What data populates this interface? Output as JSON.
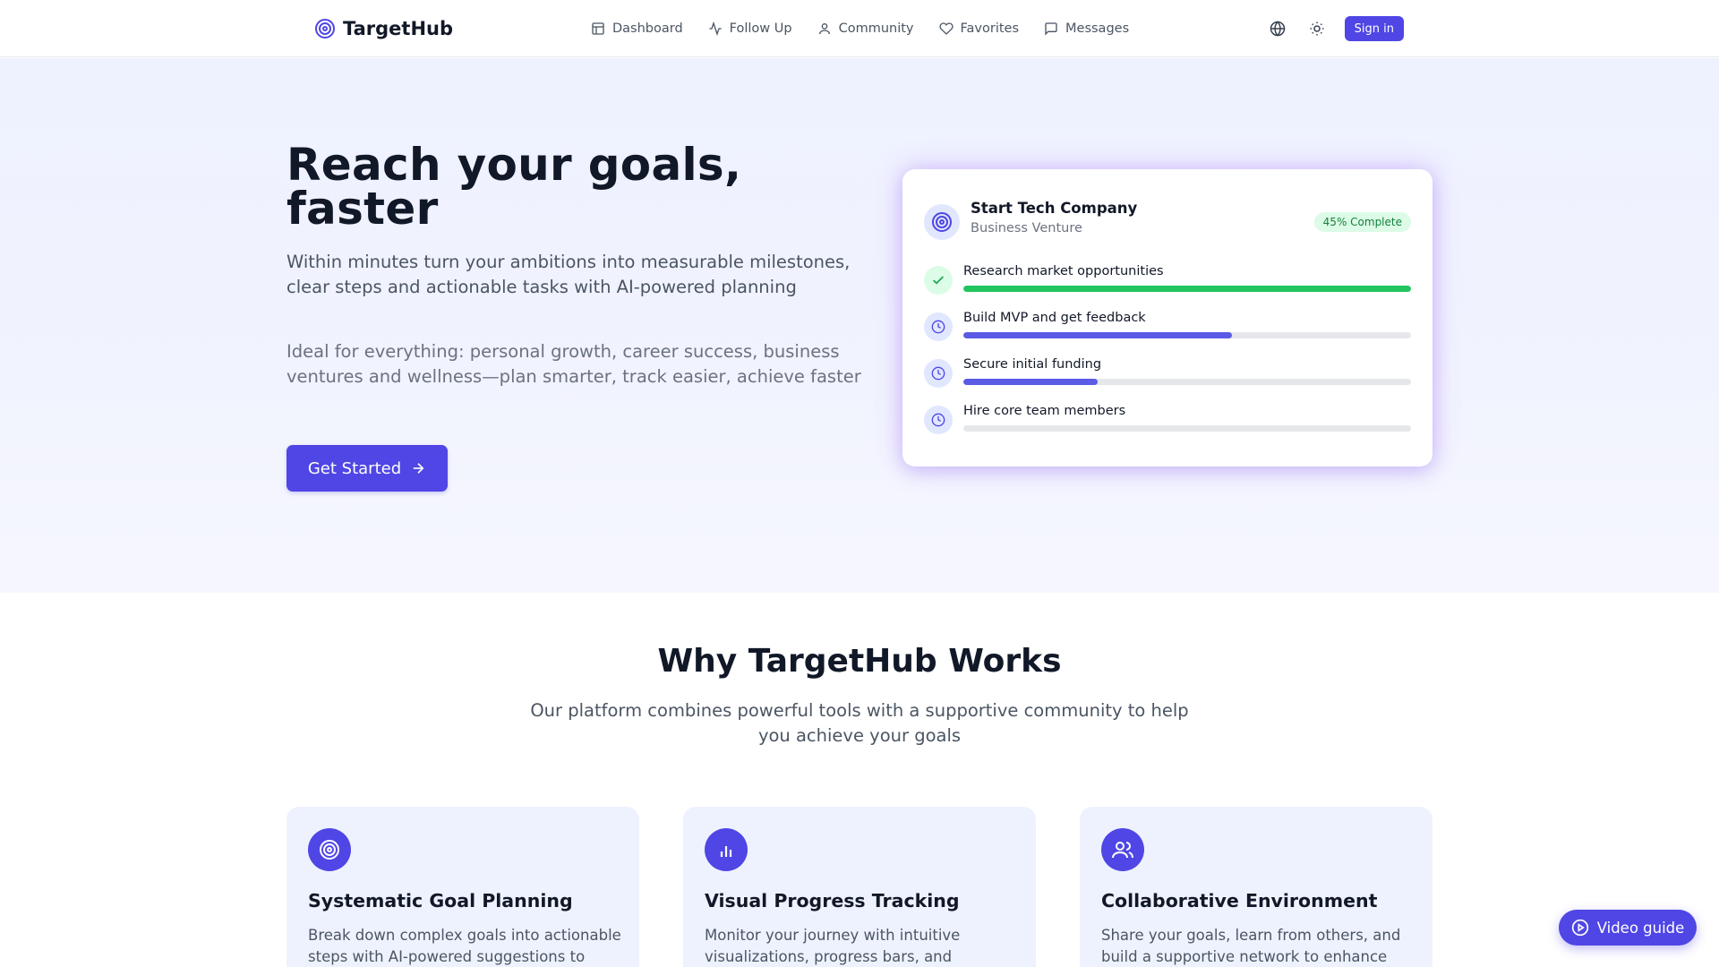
{
  "brand": {
    "name": "TargetHub",
    "icon": "target-icon",
    "color": "#4f46e5"
  },
  "nav": {
    "items": [
      {
        "label": "Dashboard",
        "icon": "layout-icon"
      },
      {
        "label": "Follow Up",
        "icon": "activity-icon"
      },
      {
        "label": "Community",
        "icon": "user-icon"
      },
      {
        "label": "Favorites",
        "icon": "heart-icon"
      },
      {
        "label": "Messages",
        "icon": "message-icon"
      }
    ],
    "language_icon": "globe-icon",
    "theme_icon": "sun-icon",
    "signin_label": "Sign in"
  },
  "hero": {
    "title": "Reach your goals, faster",
    "subtitle": "Within minutes turn your ambitions into measurable milestones, clear steps and actionable tasks with AI-powered planning",
    "subtitle2": "Ideal for everything: personal growth, career success, business ventures and wellness—plan smarter, track easier, achieve faster",
    "cta_label": "Get Started"
  },
  "goal_card": {
    "title": "Start Tech Company",
    "category": "Business Venture",
    "badge": "45% Complete",
    "steps": [
      {
        "label": "Research market opportunities",
        "status": "done",
        "progress": 1.0,
        "color": "#22c55e"
      },
      {
        "label": "Build MVP and get feedback",
        "status": "in-progress",
        "progress": 0.6,
        "color": "#5b5be6"
      },
      {
        "label": "Secure initial funding",
        "status": "in-progress",
        "progress": 0.3,
        "color": "#5b5be6"
      },
      {
        "label": "Hire core team members",
        "status": "pending",
        "progress": 0.0,
        "color": "#5b5be6"
      }
    ]
  },
  "why": {
    "title": "Why TargetHub Works",
    "subtitle": "Our platform combines powerful tools with a supportive community to help you achieve your goals",
    "features": [
      {
        "title": "Systematic Goal Planning",
        "desc": "Break down complex goals into actionable steps with AI-powered suggestions to",
        "icon": "target-icon"
      },
      {
        "title": "Visual Progress Tracking",
        "desc": "Monitor your journey with intuitive visualizations, progress bars, and",
        "icon": "bar-chart-icon"
      },
      {
        "title": "Collaborative Environment",
        "desc": "Share your goals, learn from others, and build a supportive network to enhance",
        "icon": "users-icon"
      }
    ]
  },
  "video_guide": {
    "label": "Video guide",
    "icon": "play-circle-icon"
  }
}
